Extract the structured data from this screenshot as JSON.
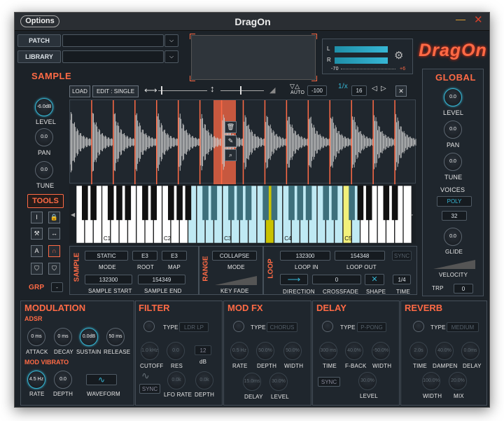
{
  "window": {
    "options_label": "Options",
    "title": "DragOn",
    "minimize_glyph": "—",
    "close_glyph": "✕"
  },
  "patch": {
    "patch_label": "PATCH",
    "library_label": "LIBRARY",
    "patch_value": "",
    "library_value": ""
  },
  "meter": {
    "l_label": "L",
    "r_label": "R",
    "min_label": "-70",
    "max_label": "+6"
  },
  "logo_text": "DragOn",
  "sample": {
    "title": "SAMPLE",
    "load_label": "LOAD",
    "edit_label": "EDIT : SINGLE",
    "auto_label": "AUTO",
    "auto_value": "-100",
    "slices_value": "16",
    "level_label": "LEVEL",
    "level_value": "-6.0dB",
    "pan_label": "PAN",
    "pan_value": "0.0",
    "tune_label": "TUNE",
    "tune_value": "0.0"
  },
  "tools": {
    "title": "TOOLS",
    "grp_label": "GRP",
    "grp_value": "-"
  },
  "keyboard": {
    "labels": [
      "C1",
      "C2",
      "C3",
      "C4",
      "C5"
    ]
  },
  "sample_params": {
    "title": "SAMPLE",
    "mode_label": "MODE",
    "mode_value": "STATIC",
    "root_label": "ROOT",
    "root_value": "E3",
    "map_label": "MAP",
    "map_value": "E3",
    "start_label": "SAMPLE START",
    "start_value": "132300",
    "end_label": "SAMPLE END",
    "end_value": "154349"
  },
  "range": {
    "title": "RANGE",
    "mode_label": "MODE",
    "mode_value": "COLLAPSE",
    "keyfade_label": "KEY FADE"
  },
  "loop": {
    "title": "LOOP",
    "in_label": "LOOP IN",
    "in_value": "132300",
    "out_label": "LOOP OUT",
    "out_value": "154348",
    "sync_label": "SYNC",
    "direction_label": "DIRECTION",
    "crossfade_label": "CROSSFADE",
    "crossfade_value": "0",
    "shape_label": "SHAPE",
    "time_label": "TIME",
    "time_value": "1/4"
  },
  "global": {
    "title": "GLOBAL",
    "level_label": "LEVEL",
    "level_value": "0.0",
    "pan_label": "PAN",
    "pan_value": "0.0",
    "tune_label": "TUNE",
    "tune_value": "0.0",
    "voices_label": "VOICES",
    "voices_mode": "POLY",
    "voices_count": "32",
    "glide_label": "GLIDE",
    "glide_value": "0.0",
    "velocity_label": "VELOCITY",
    "trp_label": "TRP",
    "trp_value": "0"
  },
  "modulation": {
    "title": "MODULATION",
    "adsr_title": "ADSR",
    "attack_label": "ATTACK",
    "attack_value": "0 ms",
    "decay_label": "DECAY",
    "decay_value": "0 ms",
    "sustain_label": "SUSTAIN",
    "sustain_value": "0.0dB",
    "release_label": "RELEASE",
    "release_value": "50 ms",
    "vibrato_title": "MOD VIBRATO",
    "rate_label": "RATE",
    "rate_value": "4.5 Hz",
    "depth_label": "DEPTH",
    "depth_value": "0.0",
    "waveform_label": "WAVEFORM"
  },
  "filter": {
    "title": "FILTER",
    "type_label": "TYPE",
    "type_value": "LDR LP",
    "cutoff_label": "CUTOFF",
    "cutoff_value": "1.0 kHz",
    "res_label": "RES",
    "res_value": "0.0",
    "db_value": "12",
    "db_label": "dB",
    "sync_label": "SYNC",
    "lfo_rate_label": "LFO RATE",
    "lfo_rate_value": "0.0k",
    "depth_label": "DEPTH",
    "depth_value": "0.0k"
  },
  "modfx": {
    "title": "MOD FX",
    "type_label": "TYPE",
    "type_value": "CHORUS",
    "rate_label": "RATE",
    "rate_value": "0.5 Hz",
    "depth_label": "DEPTH",
    "depth_value": "50.0%",
    "width_label": "WIDTH",
    "width_value": "50.0%",
    "delay_label": "DELAY",
    "delay_value": "15.0ms",
    "level_label": "LEVEL",
    "level_value": "30.0%"
  },
  "delay": {
    "title": "DELAY",
    "type_label": "TYPE",
    "type_value": "P-PONG",
    "time_label": "TIME",
    "time_value": "300 ms",
    "fback_label": "F-BACK",
    "fback_value": "40.0%",
    "width_label": "WIDTH",
    "width_value": "-50.0%",
    "sync_label": "SYNC",
    "level_label": "LEVEL",
    "level_value": "30.0%"
  },
  "reverb": {
    "title": "REVERB",
    "type_label": "TYPE",
    "type_value": "MEDIUM",
    "time_label": "TIME",
    "time_value": "2.0s",
    "dampen_label": "DAMPEN",
    "dampen_value": "40.0%",
    "delay_label": "DELAY",
    "delay_value": "0.0ms",
    "width_label": "WIDTH",
    "width_value": "100.0%",
    "mix_label": "MIX",
    "mix_value": "20.0%"
  },
  "colors": {
    "accent": "#ff6a45",
    "highlight": "#36b6d4",
    "background": "#1c2228"
  }
}
